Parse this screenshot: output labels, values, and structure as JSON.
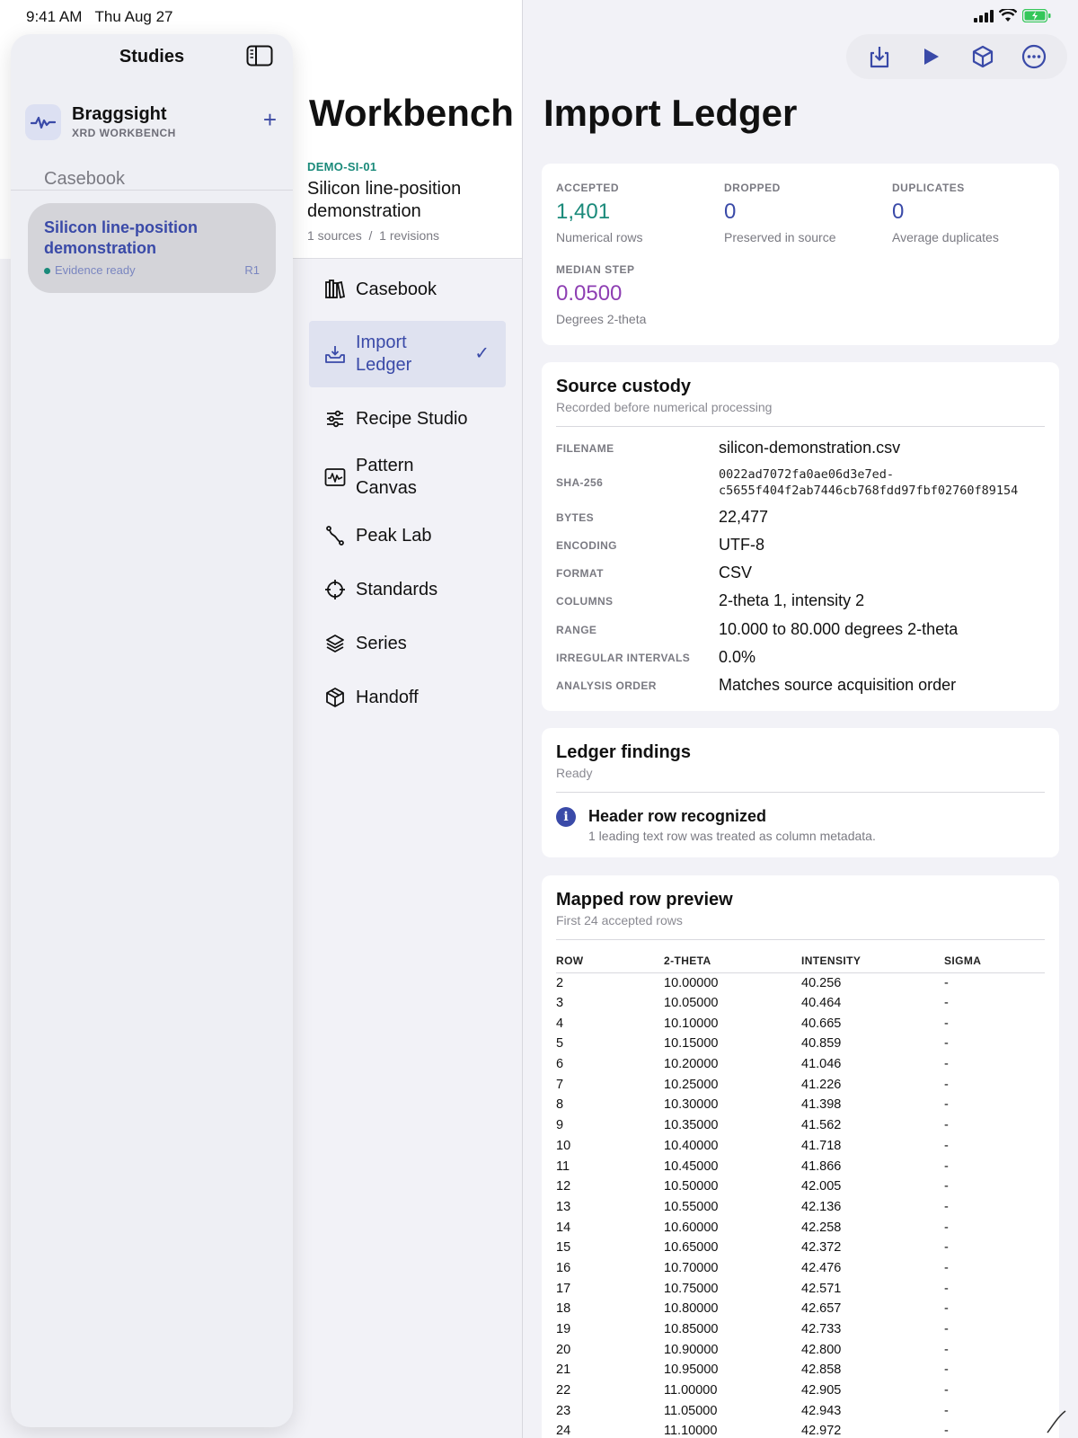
{
  "status": {
    "time": "9:41 AM",
    "date": "Thu Aug 27"
  },
  "sidebar": {
    "title": "Studies",
    "brand": {
      "name": "Braggsight",
      "subtitle": "XRD WORKBENCH"
    },
    "section": "Casebook",
    "study": {
      "title": "Silicon line-position demonstration",
      "status": "Evidence ready",
      "revision": "R1"
    }
  },
  "workbench": {
    "title": "Workbench",
    "study_id": "DEMO-SI-01",
    "study_title": "Silicon line-position demonstration",
    "meta": "1 sources  /  1 revisions",
    "nav": [
      {
        "label": "Casebook",
        "icon": "books-icon"
      },
      {
        "label": "Import Ledger",
        "icon": "tray-download-icon",
        "active": true
      },
      {
        "label": "Recipe Studio",
        "icon": "sliders-icon"
      },
      {
        "label": "Pattern Canvas",
        "icon": "waveform-icon"
      },
      {
        "label": "Peak Lab",
        "icon": "path-icon"
      },
      {
        "label": "Standards",
        "icon": "scope-icon"
      },
      {
        "label": "Series",
        "icon": "layers-icon"
      },
      {
        "label": "Handoff",
        "icon": "cube-icon"
      }
    ]
  },
  "main": {
    "title": "Import Ledger",
    "stats": {
      "accepted": {
        "label": "ACCEPTED",
        "value": "1,401",
        "sub": "Numerical rows"
      },
      "dropped": {
        "label": "DROPPED",
        "value": "0",
        "sub": "Preserved in source"
      },
      "duplicates": {
        "label": "DUPLICATES",
        "value": "0",
        "sub": "Average duplicates"
      },
      "median": {
        "label": "MEDIAN STEP",
        "value": "0.0500",
        "sub": "Degrees 2-theta"
      }
    },
    "custody": {
      "title": "Source custody",
      "subtitle": "Recorded before numerical processing",
      "rows": [
        {
          "key": "FILENAME",
          "value": "silicon-demonstration.csv"
        },
        {
          "key": "SHA-256",
          "value": "0022ad7072fa0ae06d3e7ed-",
          "value2": "c5655f404f2ab7446cb768fdd97fbf02760f89154"
        },
        {
          "key": "BYTES",
          "value": "22,477"
        },
        {
          "key": "ENCODING",
          "value": "UTF-8"
        },
        {
          "key": "FORMAT",
          "value": "CSV"
        },
        {
          "key": "COLUMNS",
          "value": "2-theta 1, intensity 2"
        },
        {
          "key": "RANGE",
          "value": "10.000 to 80.000 degrees 2-theta"
        },
        {
          "key": "IRREGULAR INTERVALS",
          "value": "0.0%"
        },
        {
          "key": "ANALYSIS ORDER",
          "value": "Matches source acquisition order"
        }
      ]
    },
    "findings": {
      "title": "Ledger findings",
      "subtitle": "Ready",
      "item_title": "Header row recognized",
      "item_text": "1 leading text row was treated as column metadata."
    },
    "preview": {
      "title": "Mapped row preview",
      "subtitle": "First 24 accepted rows",
      "headers": [
        "ROW",
        "2-THETA",
        "INTENSITY",
        "SIGMA"
      ],
      "rows": [
        [
          "2",
          "10.00000",
          "40.256",
          "-"
        ],
        [
          "3",
          "10.05000",
          "40.464",
          "-"
        ],
        [
          "4",
          "10.10000",
          "40.665",
          "-"
        ],
        [
          "5",
          "10.15000",
          "40.859",
          "-"
        ],
        [
          "6",
          "10.20000",
          "41.046",
          "-"
        ],
        [
          "7",
          "10.25000",
          "41.226",
          "-"
        ],
        [
          "8",
          "10.30000",
          "41.398",
          "-"
        ],
        [
          "9",
          "10.35000",
          "41.562",
          "-"
        ],
        [
          "10",
          "10.40000",
          "41.718",
          "-"
        ],
        [
          "11",
          "10.45000",
          "41.866",
          "-"
        ],
        [
          "12",
          "10.50000",
          "42.005",
          "-"
        ],
        [
          "13",
          "10.55000",
          "42.136",
          "-"
        ],
        [
          "14",
          "10.60000",
          "42.258",
          "-"
        ],
        [
          "15",
          "10.65000",
          "42.372",
          "-"
        ],
        [
          "16",
          "10.70000",
          "42.476",
          "-"
        ],
        [
          "17",
          "10.75000",
          "42.571",
          "-"
        ],
        [
          "18",
          "10.80000",
          "42.657",
          "-"
        ],
        [
          "19",
          "10.85000",
          "42.733",
          "-"
        ],
        [
          "20",
          "10.90000",
          "42.800",
          "-"
        ],
        [
          "21",
          "10.95000",
          "42.858",
          "-"
        ],
        [
          "22",
          "11.00000",
          "42.905",
          "-"
        ],
        [
          "23",
          "11.05000",
          "42.943",
          "-"
        ],
        [
          "24",
          "11.10000",
          "42.972",
          "-"
        ]
      ]
    }
  },
  "colors": {
    "accent": "#3a4aa8",
    "teal": "#1a8a7a",
    "purple": "#8e3fb3"
  }
}
